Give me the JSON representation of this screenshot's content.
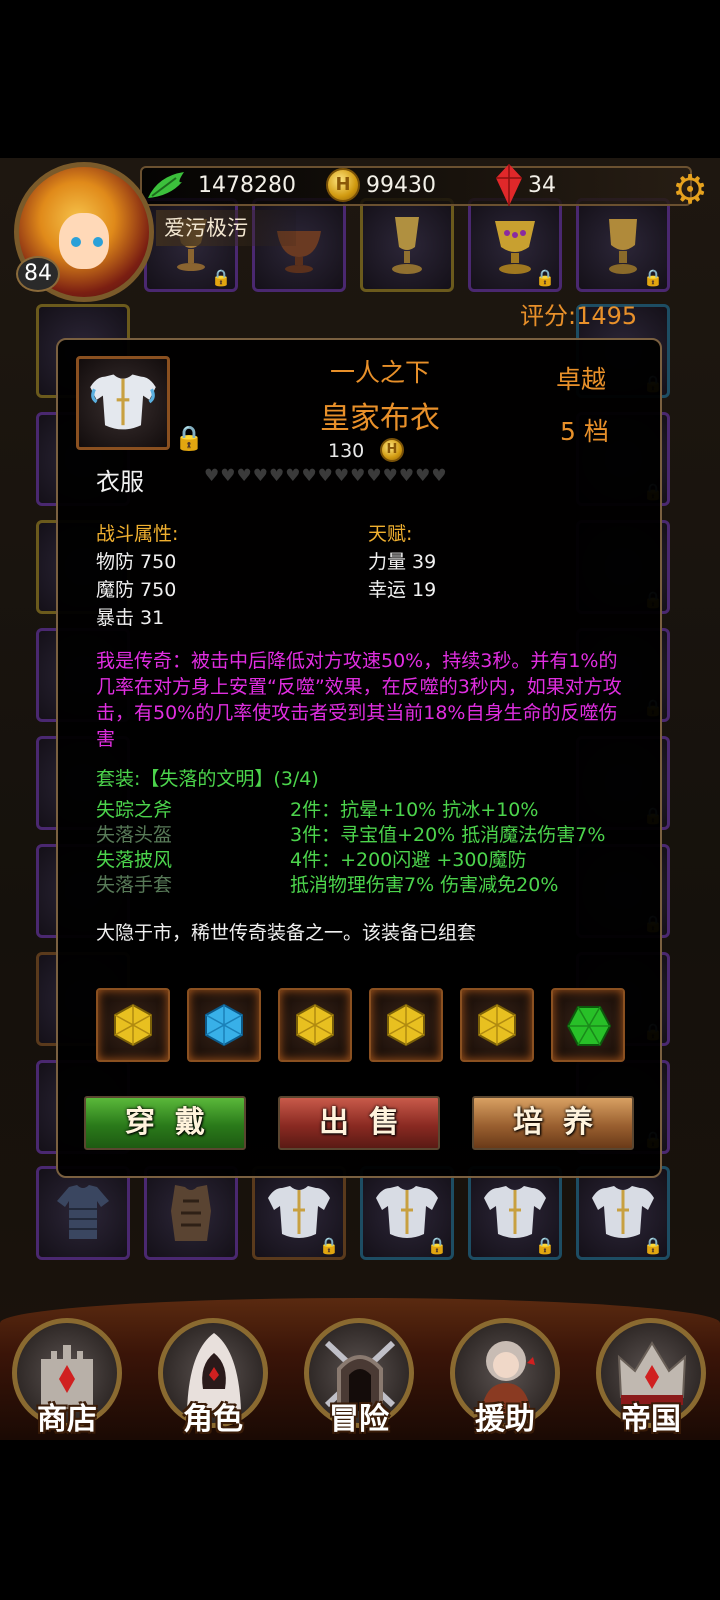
{
  "header": {
    "player_name": "爱污极污",
    "level": "84",
    "power": "1478280",
    "gold": "99430",
    "gems": "34",
    "coin_symbol": "H",
    "settings_icon": "gear-icon",
    "score_label": "评分:",
    "score_value": "1495"
  },
  "item": {
    "rank_title": "一人之下",
    "name": "皇家布衣",
    "price": "130",
    "quality": "卓越",
    "tier": "5 档",
    "slot_type": "衣服",
    "hearts": "♥♥♥♥♥♥♥♥♥♥♥♥♥♥♥",
    "combat_label": "战斗属性:",
    "combat_stats": [
      "物防 750",
      "魔防 750",
      "暴击 31"
    ],
    "talent_label": "天赋:",
    "talent_stats": [
      "力量 39",
      "幸运 19"
    ],
    "legend_text": "我是传奇：被击中后降低对方攻速50%，持续3秒。并有1%的几率在对方身上安置“反噬”效果，在反噬的3秒内，如果对方攻击，有50%的几率使攻击者受到其当前18%自身生命的反噬伤害",
    "set_title": "套装:【失落的文明】(3/4)",
    "set_pieces": [
      {
        "name": "失踪之斧",
        "owned": true
      },
      {
        "name": "失落头盔",
        "owned": false
      },
      {
        "name": "失落披风",
        "owned": true
      },
      {
        "name": "失落手套",
        "owned": false
      }
    ],
    "set_bonuses": [
      "2件：抗晕+10% 抗冰+10%",
      "3件：寻宝值+20% 抵消魔法伤害7%",
      "4件：+200闪避 +300魔防",
      "抵消物理伤害7% 伤害减免20%"
    ],
    "description": "大隐于市，稀世传奇装备之一。该装备已组套"
  },
  "gems": [
    {
      "type": "topaz",
      "color": "#e8c020"
    },
    {
      "type": "sapphire",
      "color": "#38b0e8"
    },
    {
      "type": "topaz",
      "color": "#e8c020"
    },
    {
      "type": "topaz",
      "color": "#e8c020"
    },
    {
      "type": "topaz",
      "color": "#e8c020"
    },
    {
      "type": "emerald",
      "color": "#28c028"
    }
  ],
  "actions": {
    "equip": "穿戴",
    "sell": "出售",
    "upgrade": "培养"
  },
  "nav": [
    {
      "label": "商店",
      "icon": "castle-icon"
    },
    {
      "label": "角色",
      "icon": "hooded-figure-icon"
    },
    {
      "label": "冒险",
      "icon": "dungeon-gate-icon"
    },
    {
      "label": "援助",
      "icon": "helper-girl-icon"
    },
    {
      "label": "帝国",
      "icon": "crown-icon"
    }
  ],
  "colors": {
    "accent_orange": "#e8902a",
    "legend_magenta": "#e02ee0",
    "set_green": "#4cd44c",
    "stat_header": "#f0b030"
  }
}
